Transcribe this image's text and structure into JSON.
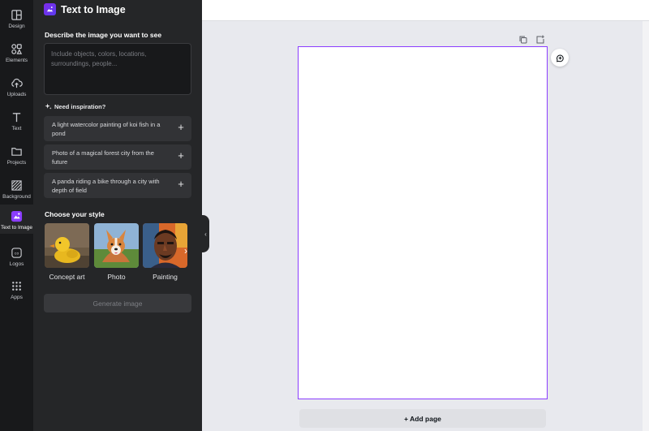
{
  "rail": [
    {
      "label": "Design",
      "icon": "layout-icon"
    },
    {
      "label": "Elements",
      "icon": "shapes-icon"
    },
    {
      "label": "Uploads",
      "icon": "cloud-upload-icon"
    },
    {
      "label": "Text",
      "icon": "text-icon"
    },
    {
      "label": "Projects",
      "icon": "folder-icon"
    },
    {
      "label": "Background",
      "icon": "hatch-icon"
    },
    {
      "label": "Text to Image",
      "icon": "text-to-image-icon"
    },
    {
      "label": "Logos",
      "icon": "logo-icon"
    },
    {
      "label": "Apps",
      "icon": "grid-icon"
    }
  ],
  "panel": {
    "title": "Text to Image",
    "describe_label": "Describe the image you want to see",
    "prompt_placeholder": "Include objects, colors, locations, surroundings, people...",
    "inspiration_label": "Need inspiration?",
    "suggestions": [
      "A light watercolor painting of koi fish in a pond",
      "Photo of a magical forest city from the future",
      "A panda riding a bike through a city with depth of field"
    ],
    "style_label": "Choose your style",
    "styles": [
      "Concept art",
      "Photo",
      "Painting"
    ],
    "generate_label": "Generate image"
  },
  "canvas": {
    "add_page_label": "+ Add page"
  },
  "colors": {
    "accent": "#8b3dff",
    "rail_bg": "#18191b",
    "panel_bg": "#252628"
  }
}
